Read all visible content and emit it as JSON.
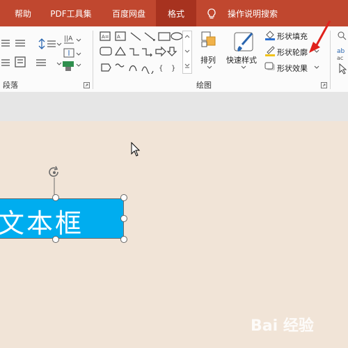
{
  "tabs": [
    {
      "label": "帮助"
    },
    {
      "label": "PDF工具集"
    },
    {
      "label": "百度网盘"
    },
    {
      "label": "格式"
    },
    {
      "label": "操作说明搜索"
    }
  ],
  "ribbon": {
    "paragraph_group_label": "段落",
    "drawing_group_label": "绘图",
    "arrange_label": "排列",
    "quick_styles_label": "快速样式",
    "shape_fill_label": "形状填充",
    "shape_outline_label": "形状轮廓",
    "shape_effects_label": "形状效果"
  },
  "slide": {
    "textbox_text": "文本框"
  },
  "watermark": {
    "text": "Bai 经验"
  },
  "colors": {
    "tab_bar": "#c0472f",
    "active_tab": "#a7321f",
    "textbox_fill": "#00adef",
    "slide_bg": "#f1e4d7",
    "arrow": "#e0221c"
  }
}
